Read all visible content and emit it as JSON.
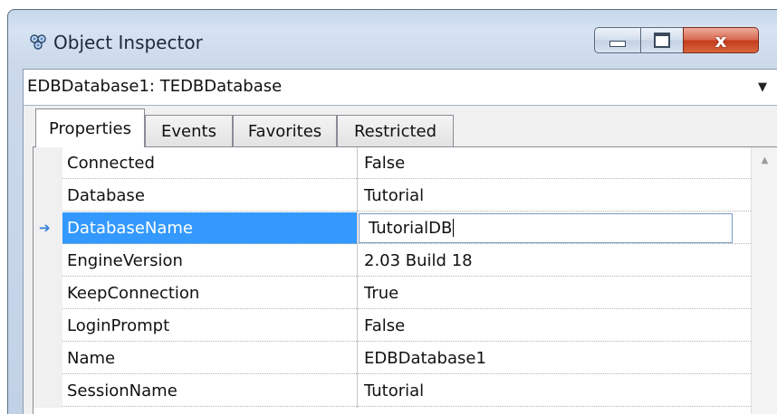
{
  "window": {
    "title": "Object Inspector",
    "close_symbol": "x",
    "icons": {
      "app": "object-inspector-icon",
      "minimize": "minimize-icon",
      "maximize": "maximize-icon",
      "close": "close-icon"
    }
  },
  "object_selector": {
    "value": "EDBDatabase1: TEDBDatabase",
    "dropdown_icon": "chevron-down-icon"
  },
  "tabs": [
    {
      "label": "Properties",
      "active": true
    },
    {
      "label": "Events",
      "active": false
    },
    {
      "label": "Favorites",
      "active": false
    },
    {
      "label": "Restricted",
      "active": false
    }
  ],
  "properties": [
    {
      "name": "Connected",
      "value": "False"
    },
    {
      "name": "Database",
      "value": "Tutorial"
    },
    {
      "name": "DatabaseName",
      "value": "TutorialDB",
      "selected": true,
      "editing": true
    },
    {
      "name": "EngineVersion",
      "value": "2.03 Build 18"
    },
    {
      "name": "KeepConnection",
      "value": "True"
    },
    {
      "name": "LoginPrompt",
      "value": "False"
    },
    {
      "name": "Name",
      "value": "EDBDatabase1"
    },
    {
      "name": "SessionName",
      "value": "Tutorial"
    }
  ],
  "colors": {
    "selection": "#3399ff",
    "close_button": "#c4391c"
  }
}
